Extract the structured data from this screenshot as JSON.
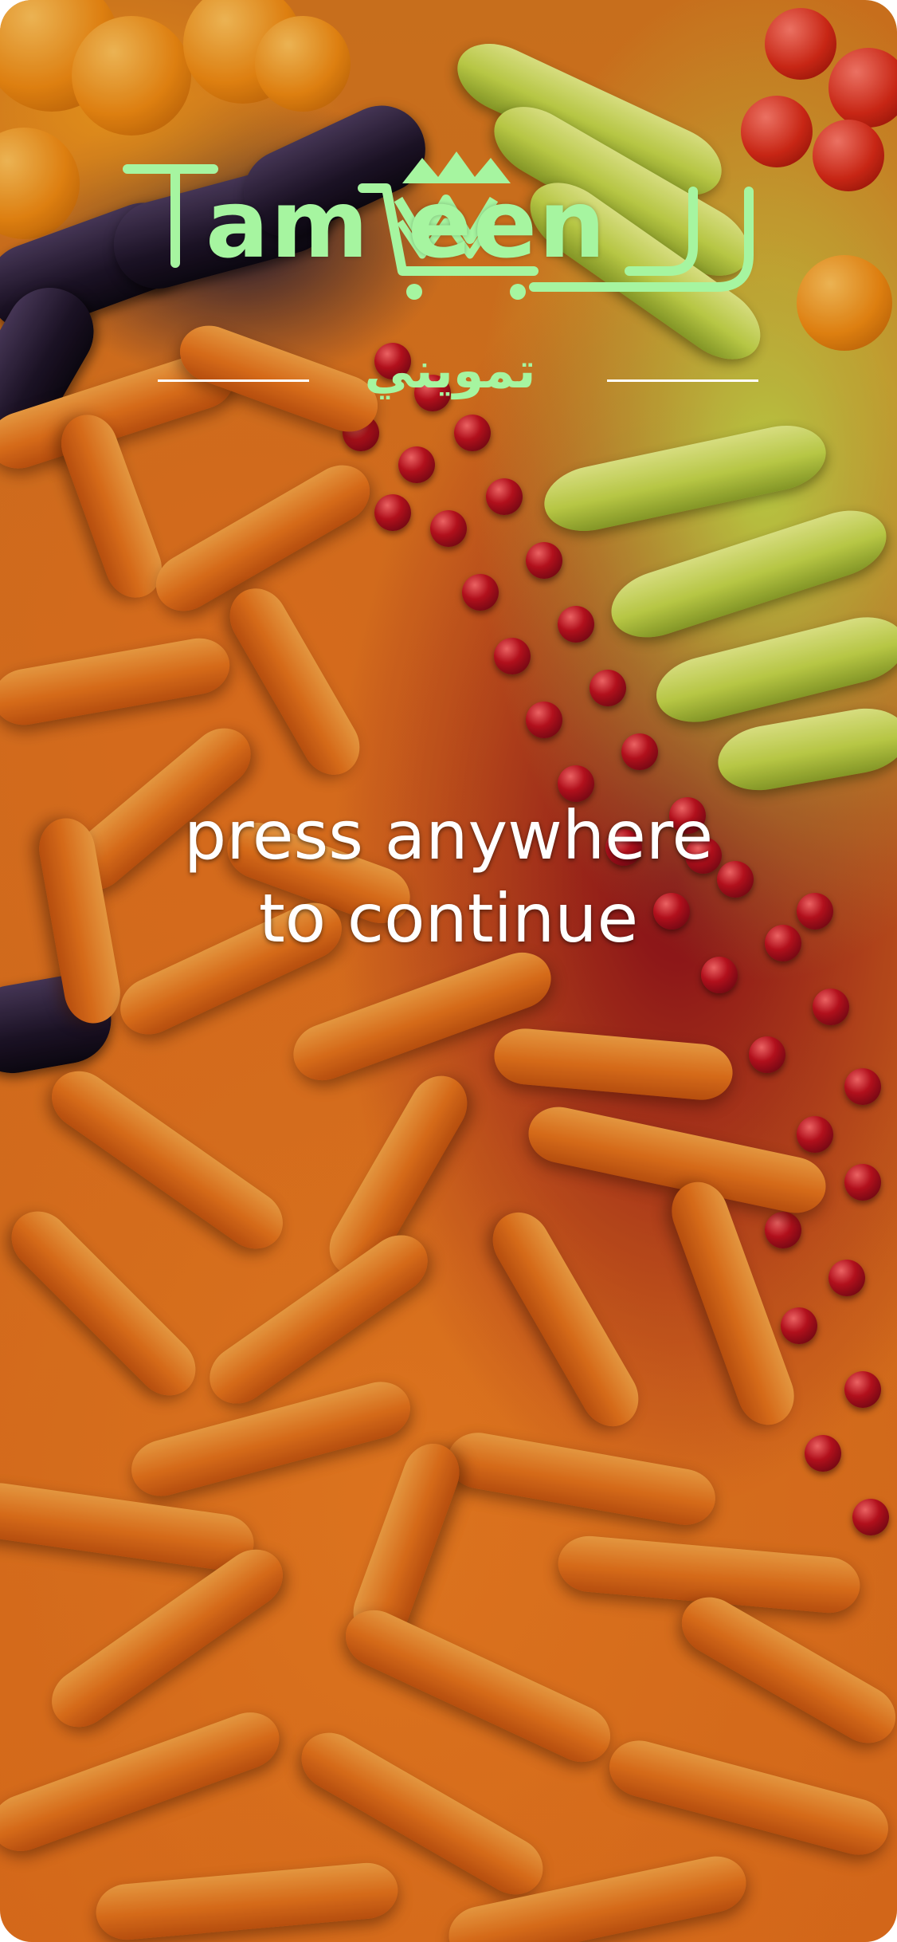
{
  "app": {
    "logo_text_left": "am",
    "logo_text_right": "een",
    "logo_arabic": "تمويني",
    "brand_color": "#a6f5a0",
    "logo_icon": "shopping-cart-crown-icon"
  },
  "prompt": {
    "line1": "press anywhere",
    "line2": "to continue"
  },
  "background": {
    "image": "produce-market-photo"
  }
}
